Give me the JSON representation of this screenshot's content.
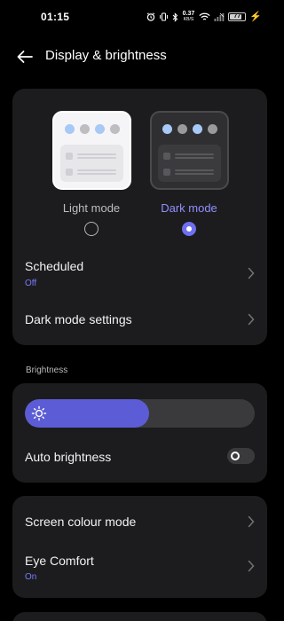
{
  "status_bar": {
    "time": "01:15",
    "network_speed": "0.37",
    "network_speed_unit": "KB/S",
    "battery": "77"
  },
  "header": {
    "title": "Display & brightness"
  },
  "theme": {
    "light_label": "Light mode",
    "dark_label": "Dark mode",
    "selected": "dark"
  },
  "scheduled": {
    "title": "Scheduled",
    "value": "Off"
  },
  "dark_mode_settings": {
    "title": "Dark mode settings"
  },
  "brightness": {
    "section_label": "Brightness",
    "level": 0.54,
    "auto_label": "Auto brightness",
    "auto_enabled": false
  },
  "screen_colour_mode": {
    "title": "Screen colour mode"
  },
  "eye_comfort": {
    "title": "Eye Comfort",
    "value": "On"
  },
  "colors": {
    "accent": "#6f6ff0",
    "slider_fill": "#5c5cd6",
    "card": "#1c1c1e",
    "preview_dot_blue": "#a8c8f5",
    "preview_dot_grey": "#9a9a9e"
  }
}
